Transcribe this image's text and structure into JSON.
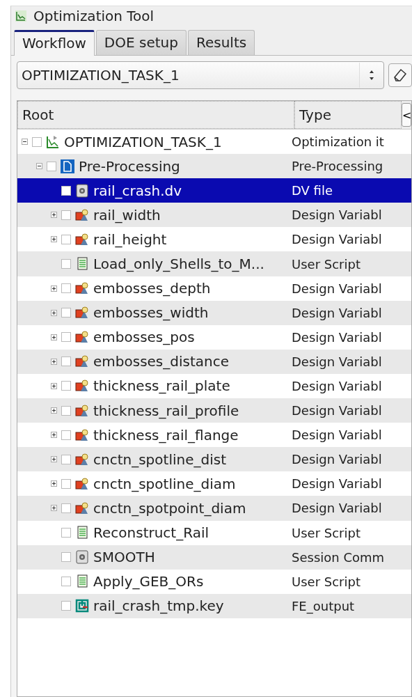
{
  "window": {
    "title": "Optimization Tool"
  },
  "tabs": [
    {
      "label": "Workflow",
      "selected": true
    },
    {
      "label": "DOE setup",
      "selected": false
    },
    {
      "label": "Results",
      "selected": false
    }
  ],
  "task_select": {
    "value": "OPTIMIZATION_TASK_1"
  },
  "table": {
    "columns": [
      "Root",
      "Type"
    ],
    "collapse_button": "<",
    "tree": [
      {
        "name": "OPTIMIZATION_TASK_1",
        "type": "Optimization it",
        "kind": "task",
        "expanded": true,
        "checked": false,
        "selected": false,
        "children": [
          {
            "name": "Pre-Processing",
            "type": "Pre-Processing",
            "kind": "preprocessing",
            "expanded": true,
            "checked": false,
            "selected": false,
            "children": [
              {
                "name": "rail_crash.dv",
                "type": "DV file",
                "kind": "dvfile",
                "checked": false,
                "selected": true
              },
              {
                "name": "rail_width",
                "type": "Design Variabl",
                "kind": "variable",
                "expanded": false,
                "checked": false,
                "selected": false
              },
              {
                "name": "rail_height",
                "type": "Design Variabl",
                "kind": "variable",
                "expanded": false,
                "checked": false,
                "selected": false
              },
              {
                "name": "Load_only_Shells_to_M...",
                "type": "User Script",
                "kind": "script",
                "checked": false,
                "selected": false
              },
              {
                "name": "embosses_depth",
                "type": "Design Variabl",
                "kind": "variable",
                "expanded": false,
                "checked": false,
                "selected": false
              },
              {
                "name": "embosses_width",
                "type": "Design Variabl",
                "kind": "variable",
                "expanded": false,
                "checked": false,
                "selected": false
              },
              {
                "name": "embosses_pos",
                "type": "Design Variabl",
                "kind": "variable",
                "expanded": false,
                "checked": false,
                "selected": false
              },
              {
                "name": "embosses_distance",
                "type": "Design Variabl",
                "kind": "variable",
                "expanded": false,
                "checked": false,
                "selected": false
              },
              {
                "name": "thickness_rail_plate",
                "type": "Design Variabl",
                "kind": "variable",
                "expanded": false,
                "checked": false,
                "selected": false
              },
              {
                "name": "thickness_rail_profile",
                "type": "Design Variabl",
                "kind": "variable",
                "expanded": false,
                "checked": false,
                "selected": false
              },
              {
                "name": "thickness_rail_flange",
                "type": "Design Variabl",
                "kind": "variable",
                "expanded": false,
                "checked": false,
                "selected": false
              },
              {
                "name": "cnctn_spotline_dist",
                "type": "Design Variabl",
                "kind": "variable",
                "expanded": false,
                "checked": false,
                "selected": false
              },
              {
                "name": "cnctn_spotline_diam",
                "type": "Design Variabl",
                "kind": "variable",
                "expanded": false,
                "checked": false,
                "selected": false
              },
              {
                "name": "cnctn_spotpoint_diam",
                "type": "Design Variabl",
                "kind": "variable",
                "expanded": false,
                "checked": false,
                "selected": false
              },
              {
                "name": "Reconstruct_Rail",
                "type": "User Script",
                "kind": "script",
                "checked": false,
                "selected": false
              },
              {
                "name": "SMOOTH",
                "type": "Session Comm",
                "kind": "session",
                "checked": false,
                "selected": false
              },
              {
                "name": "Apply_GEB_ORs",
                "type": "User Script",
                "kind": "script",
                "checked": false,
                "selected": false
              },
              {
                "name": "rail_crash_tmp.key",
                "type": "FE_output",
                "kind": "output",
                "checked": false,
                "selected": false
              }
            ]
          }
        ]
      }
    ]
  }
}
